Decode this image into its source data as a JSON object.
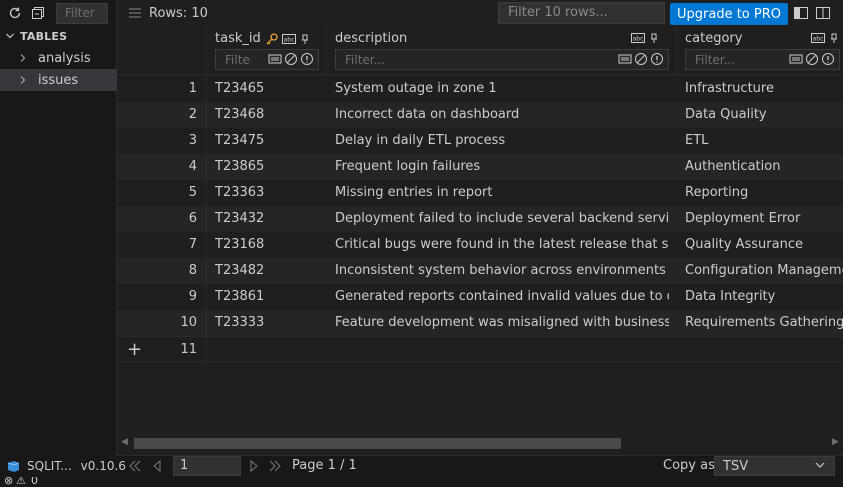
{
  "sidebar": {
    "filter_placeholder": "Filter",
    "section_title": "TABLES",
    "items": [
      {
        "label": "analysis"
      },
      {
        "label": "issues"
      }
    ],
    "app_name": "SQLIT...",
    "version": "v0.10.6"
  },
  "toolbar": {
    "rows_label": "Rows: 10",
    "filter_placeholder": "Filter 10 rows...",
    "upgrade_label": "Upgrade to PRO"
  },
  "columns": [
    {
      "name": "task_id",
      "filter_placeholder": "Filter..."
    },
    {
      "name": "description",
      "filter_placeholder": "Filter..."
    },
    {
      "name": "category",
      "filter_placeholder": "Filter..."
    }
  ],
  "rows": [
    {
      "n": "1",
      "task_id": "T23465",
      "description": "System outage in zone 1",
      "category": "Infrastructure"
    },
    {
      "n": "2",
      "task_id": "T23468",
      "description": "Incorrect data on dashboard",
      "category": "Data Quality"
    },
    {
      "n": "3",
      "task_id": "T23475",
      "description": "Delay in daily ETL process",
      "category": "ETL"
    },
    {
      "n": "4",
      "task_id": "T23865",
      "description": "Frequent login failures",
      "category": "Authentication"
    },
    {
      "n": "5",
      "task_id": "T23363",
      "description": "Missing entries in report",
      "category": "Reporting"
    },
    {
      "n": "6",
      "task_id": "T23432",
      "description": "Deployment failed to include several backend services c...",
      "category": "Deployment Error"
    },
    {
      "n": "7",
      "task_id": "T23168",
      "description": "Critical bugs were found in the latest release that slippe...",
      "category": "Quality Assurance"
    },
    {
      "n": "8",
      "task_id": "T23482",
      "description": "Inconsistent system behavior across environments trace...",
      "category": "Configuration Management"
    },
    {
      "n": "9",
      "task_id": "T23861",
      "description": "Generated reports contained invalid values due to data ...",
      "category": "Data Integrity"
    },
    {
      "n": "10",
      "task_id": "T23333",
      "description": "Feature development was misaligned with business nee...",
      "category": "Requirements Gathering"
    }
  ],
  "new_row_number": "11",
  "pager": {
    "page_value": "1",
    "page_label": "Page 1 / 1",
    "copy_label": "Copy as",
    "copy_format": "TSV"
  },
  "status": {
    "errors": "0",
    "warnings": "0"
  },
  "colors": {
    "accent": "#0078d4",
    "background": "#1f1f1f",
    "sidebar": "#181818",
    "selected": "#37373d",
    "key_icon": "#e8a33d"
  },
  "icons": [
    "refresh-icon",
    "collapse-icon",
    "chevron-down-icon",
    "chevron-right-icon",
    "menu-icon",
    "sidebar-toggle-icon",
    "split-icon",
    "key-icon",
    "text-type-icon",
    "pin-icon",
    "filter-mode-icon",
    "null-icon",
    "info-icon",
    "plus-icon",
    "first-page-icon",
    "prev-page-icon",
    "next-page-icon",
    "last-page-icon",
    "database-icon"
  ]
}
